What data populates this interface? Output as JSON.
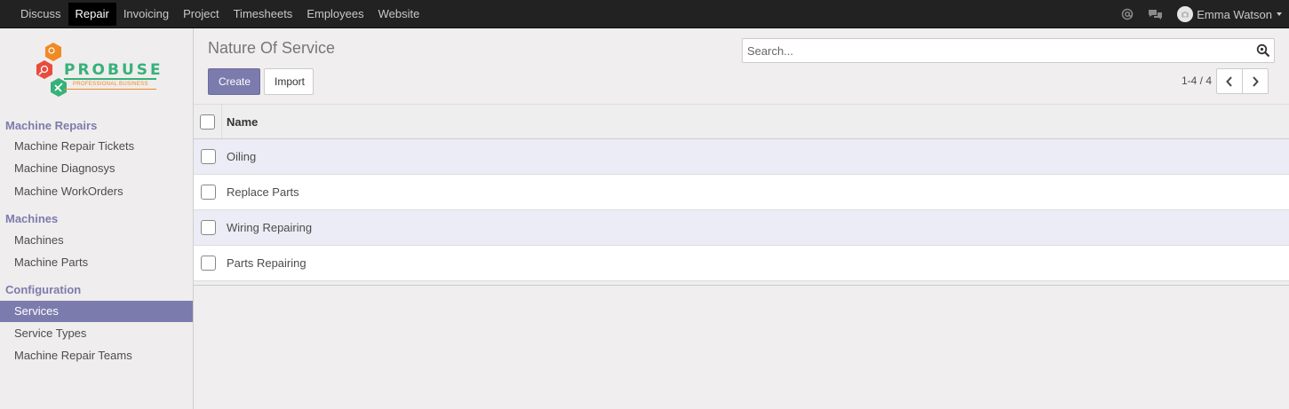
{
  "topnav": {
    "items": [
      {
        "label": "Discuss"
      },
      {
        "label": "Repair"
      },
      {
        "label": "Invoicing"
      },
      {
        "label": "Project"
      },
      {
        "label": "Timesheets"
      },
      {
        "label": "Employees"
      },
      {
        "label": "Website"
      }
    ],
    "active_index": 1,
    "user_name": "Emma Watson",
    "icons": [
      "at-icon",
      "chat-icon",
      "avatar",
      "caret-down-icon"
    ]
  },
  "logo": {
    "brand": "PROBUSE",
    "tagline": "PROFESSIONAL BUSINESS"
  },
  "sidebar": {
    "sections": [
      {
        "title": "Machine Repairs",
        "items": [
          {
            "label": "Machine Repair Tickets"
          },
          {
            "label": "Machine Diagnosys"
          },
          {
            "label": "Machine WorkOrders"
          }
        ]
      },
      {
        "title": "Machines",
        "items": [
          {
            "label": "Machines"
          },
          {
            "label": "Machine Parts"
          }
        ]
      },
      {
        "title": "Configuration",
        "items": [
          {
            "label": "Services"
          },
          {
            "label": "Service Types"
          },
          {
            "label": "Machine Repair Teams"
          }
        ]
      }
    ],
    "active_item": "Services"
  },
  "control_panel": {
    "title": "Nature Of Service",
    "create_label": "Create",
    "import_label": "Import",
    "search_placeholder": "Search...",
    "pager": "1-4 / 4"
  },
  "table": {
    "columns": [
      "Name"
    ],
    "rows": [
      {
        "name": "Oiling"
      },
      {
        "name": "Replace Parts"
      },
      {
        "name": "Wiring Repairing"
      },
      {
        "name": "Parts Repairing"
      }
    ]
  },
  "colors": {
    "accent": "#7c7bad",
    "topbar": "#222222",
    "row_alt": "#ececf6"
  }
}
